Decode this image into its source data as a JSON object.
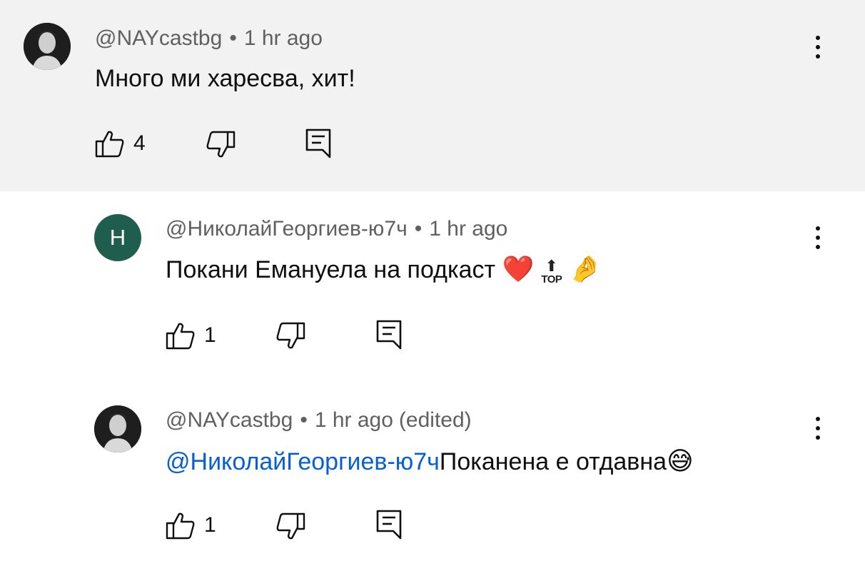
{
  "comments": [
    {
      "author": "@NAYcastbg",
      "time": "1 hr ago",
      "text": "Много ми харесва, хит!",
      "likes": "4"
    },
    {
      "avatar_letter": "Н",
      "author": "@НиколайГеоргиев-ю7ч",
      "time": "1 hr ago",
      "text": "Покани Емануела на подкаст ",
      "emojis": {
        "heart": "❤️",
        "top_arrow": "⬆",
        "top_label": "TOP",
        "pinch": "🤌"
      },
      "likes": "1"
    },
    {
      "author": "@NAYcastbg",
      "time": "1 hr ago",
      "edited": "(edited)",
      "mention": "@НиколайГеоргиев-ю7ч",
      "text": "Поканена е отдавна",
      "emoji": "😅",
      "likes": "1"
    }
  ],
  "separator": "•",
  "icons": {
    "like": "thumbs-up-icon",
    "dislike": "thumbs-down-icon",
    "reply": "reply-icon",
    "more": "more-vertical-icon"
  },
  "colors": {
    "highlight_bg": "#f2f2f2",
    "mention": "#065fd4",
    "avatar_letter_bg": "#1f5e4e"
  }
}
